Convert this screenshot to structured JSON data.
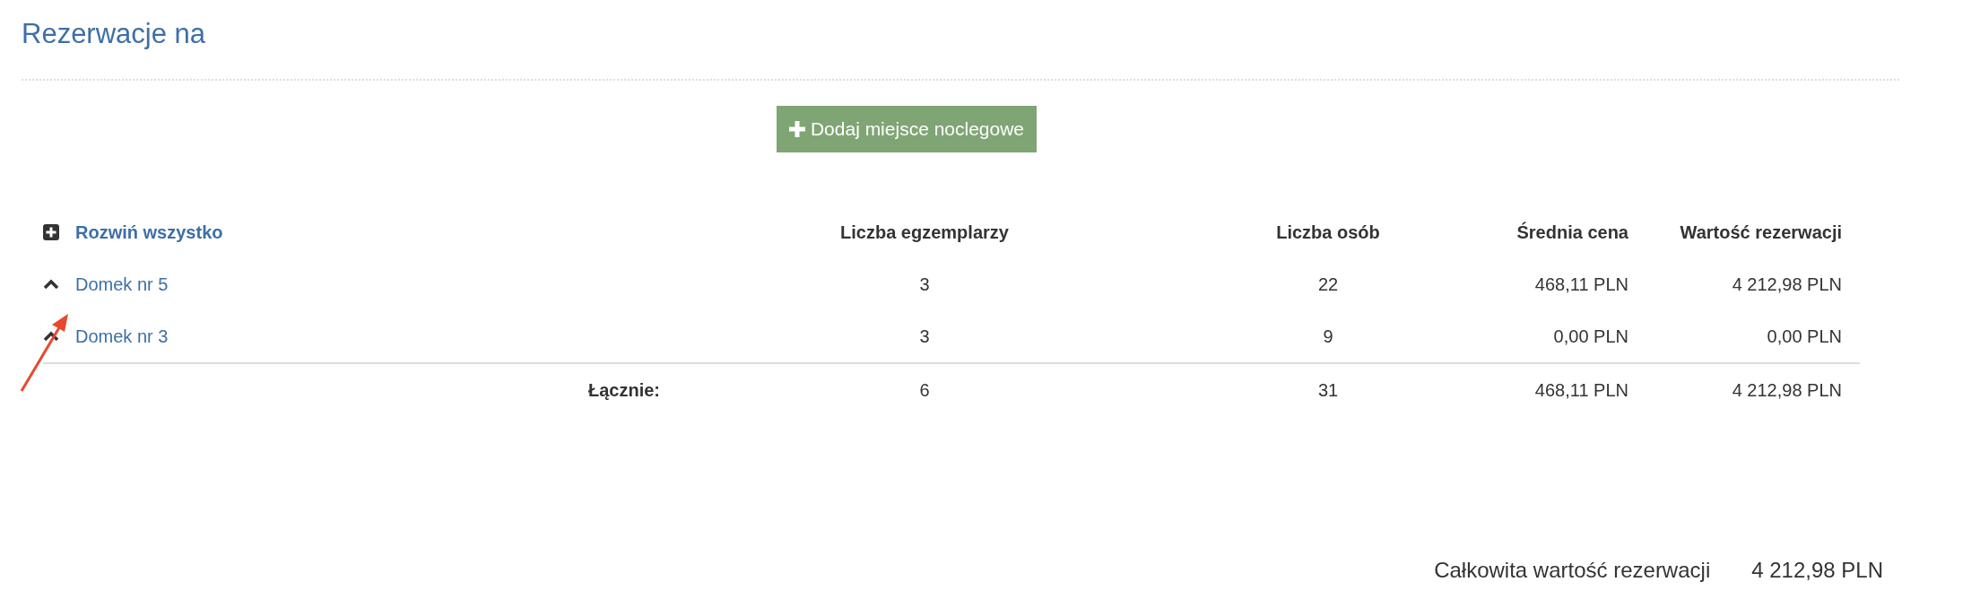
{
  "title": "Rezerwacje na",
  "add_button": {
    "label": "Dodaj miejsce noclegowe"
  },
  "table": {
    "expand_all": "Rozwiń wszystko",
    "columns": [
      "Liczba egzemplarzy",
      "Liczba osób",
      "Średnia cena",
      "Wartość rezerwacji"
    ],
    "rows": [
      {
        "name": "Domek nr 5",
        "expanded": true,
        "cells": [
          "3",
          "22",
          "468,11 PLN",
          "4 212,98 PLN"
        ]
      },
      {
        "name": "Domek nr 3",
        "expanded": true,
        "cells": [
          "3",
          "9",
          "0,00 PLN",
          "0,00 PLN"
        ]
      }
    ],
    "totals": {
      "label": "Łącznie:",
      "cells": [
        "6",
        "31",
        "468,11 PLN",
        "4 212,98 PLN"
      ]
    }
  },
  "summary": {
    "label": "Całkowita wartość rezerwacji",
    "value": "4 212,98 PLN"
  }
}
